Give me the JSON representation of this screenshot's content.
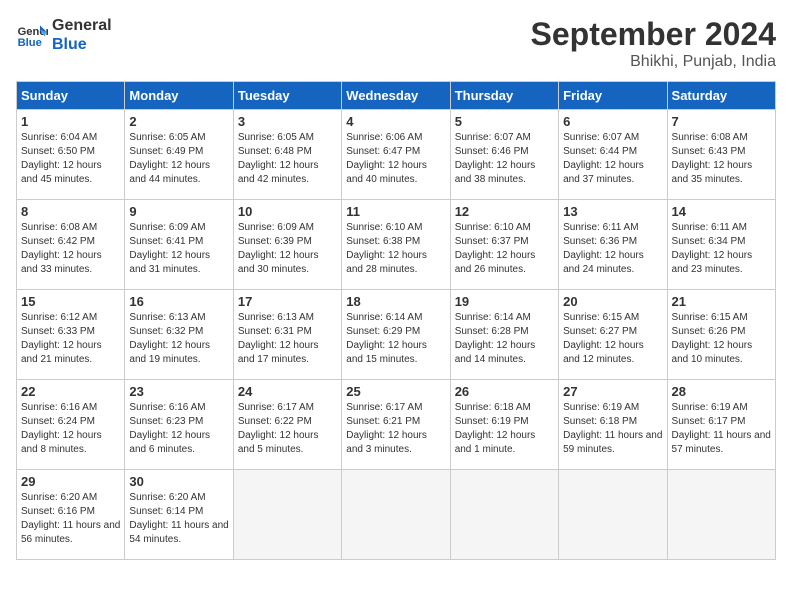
{
  "header": {
    "logo_line1": "General",
    "logo_line2": "Blue",
    "month": "September 2024",
    "location": "Bhikhi, Punjab, India"
  },
  "weekdays": [
    "Sunday",
    "Monday",
    "Tuesday",
    "Wednesday",
    "Thursday",
    "Friday",
    "Saturday"
  ],
  "weeks": [
    [
      {
        "day": "1",
        "info": "Sunrise: 6:04 AM\nSunset: 6:50 PM\nDaylight: 12 hours and 45 minutes."
      },
      {
        "day": "2",
        "info": "Sunrise: 6:05 AM\nSunset: 6:49 PM\nDaylight: 12 hours and 44 minutes."
      },
      {
        "day": "3",
        "info": "Sunrise: 6:05 AM\nSunset: 6:48 PM\nDaylight: 12 hours and 42 minutes."
      },
      {
        "day": "4",
        "info": "Sunrise: 6:06 AM\nSunset: 6:47 PM\nDaylight: 12 hours and 40 minutes."
      },
      {
        "day": "5",
        "info": "Sunrise: 6:07 AM\nSunset: 6:46 PM\nDaylight: 12 hours and 38 minutes."
      },
      {
        "day": "6",
        "info": "Sunrise: 6:07 AM\nSunset: 6:44 PM\nDaylight: 12 hours and 37 minutes."
      },
      {
        "day": "7",
        "info": "Sunrise: 6:08 AM\nSunset: 6:43 PM\nDaylight: 12 hours and 35 minutes."
      }
    ],
    [
      {
        "day": "8",
        "info": "Sunrise: 6:08 AM\nSunset: 6:42 PM\nDaylight: 12 hours and 33 minutes."
      },
      {
        "day": "9",
        "info": "Sunrise: 6:09 AM\nSunset: 6:41 PM\nDaylight: 12 hours and 31 minutes."
      },
      {
        "day": "10",
        "info": "Sunrise: 6:09 AM\nSunset: 6:39 PM\nDaylight: 12 hours and 30 minutes."
      },
      {
        "day": "11",
        "info": "Sunrise: 6:10 AM\nSunset: 6:38 PM\nDaylight: 12 hours and 28 minutes."
      },
      {
        "day": "12",
        "info": "Sunrise: 6:10 AM\nSunset: 6:37 PM\nDaylight: 12 hours and 26 minutes."
      },
      {
        "day": "13",
        "info": "Sunrise: 6:11 AM\nSunset: 6:36 PM\nDaylight: 12 hours and 24 minutes."
      },
      {
        "day": "14",
        "info": "Sunrise: 6:11 AM\nSunset: 6:34 PM\nDaylight: 12 hours and 23 minutes."
      }
    ],
    [
      {
        "day": "15",
        "info": "Sunrise: 6:12 AM\nSunset: 6:33 PM\nDaylight: 12 hours and 21 minutes."
      },
      {
        "day": "16",
        "info": "Sunrise: 6:13 AM\nSunset: 6:32 PM\nDaylight: 12 hours and 19 minutes."
      },
      {
        "day": "17",
        "info": "Sunrise: 6:13 AM\nSunset: 6:31 PM\nDaylight: 12 hours and 17 minutes."
      },
      {
        "day": "18",
        "info": "Sunrise: 6:14 AM\nSunset: 6:29 PM\nDaylight: 12 hours and 15 minutes."
      },
      {
        "day": "19",
        "info": "Sunrise: 6:14 AM\nSunset: 6:28 PM\nDaylight: 12 hours and 14 minutes."
      },
      {
        "day": "20",
        "info": "Sunrise: 6:15 AM\nSunset: 6:27 PM\nDaylight: 12 hours and 12 minutes."
      },
      {
        "day": "21",
        "info": "Sunrise: 6:15 AM\nSunset: 6:26 PM\nDaylight: 12 hours and 10 minutes."
      }
    ],
    [
      {
        "day": "22",
        "info": "Sunrise: 6:16 AM\nSunset: 6:24 PM\nDaylight: 12 hours and 8 minutes."
      },
      {
        "day": "23",
        "info": "Sunrise: 6:16 AM\nSunset: 6:23 PM\nDaylight: 12 hours and 6 minutes."
      },
      {
        "day": "24",
        "info": "Sunrise: 6:17 AM\nSunset: 6:22 PM\nDaylight: 12 hours and 5 minutes."
      },
      {
        "day": "25",
        "info": "Sunrise: 6:17 AM\nSunset: 6:21 PM\nDaylight: 12 hours and 3 minutes."
      },
      {
        "day": "26",
        "info": "Sunrise: 6:18 AM\nSunset: 6:19 PM\nDaylight: 12 hours and 1 minute."
      },
      {
        "day": "27",
        "info": "Sunrise: 6:19 AM\nSunset: 6:18 PM\nDaylight: 11 hours and 59 minutes."
      },
      {
        "day": "28",
        "info": "Sunrise: 6:19 AM\nSunset: 6:17 PM\nDaylight: 11 hours and 57 minutes."
      }
    ],
    [
      {
        "day": "29",
        "info": "Sunrise: 6:20 AM\nSunset: 6:16 PM\nDaylight: 11 hours and 56 minutes."
      },
      {
        "day": "30",
        "info": "Sunrise: 6:20 AM\nSunset: 6:14 PM\nDaylight: 11 hours and 54 minutes."
      },
      {
        "day": "",
        "info": ""
      },
      {
        "day": "",
        "info": ""
      },
      {
        "day": "",
        "info": ""
      },
      {
        "day": "",
        "info": ""
      },
      {
        "day": "",
        "info": ""
      }
    ]
  ]
}
